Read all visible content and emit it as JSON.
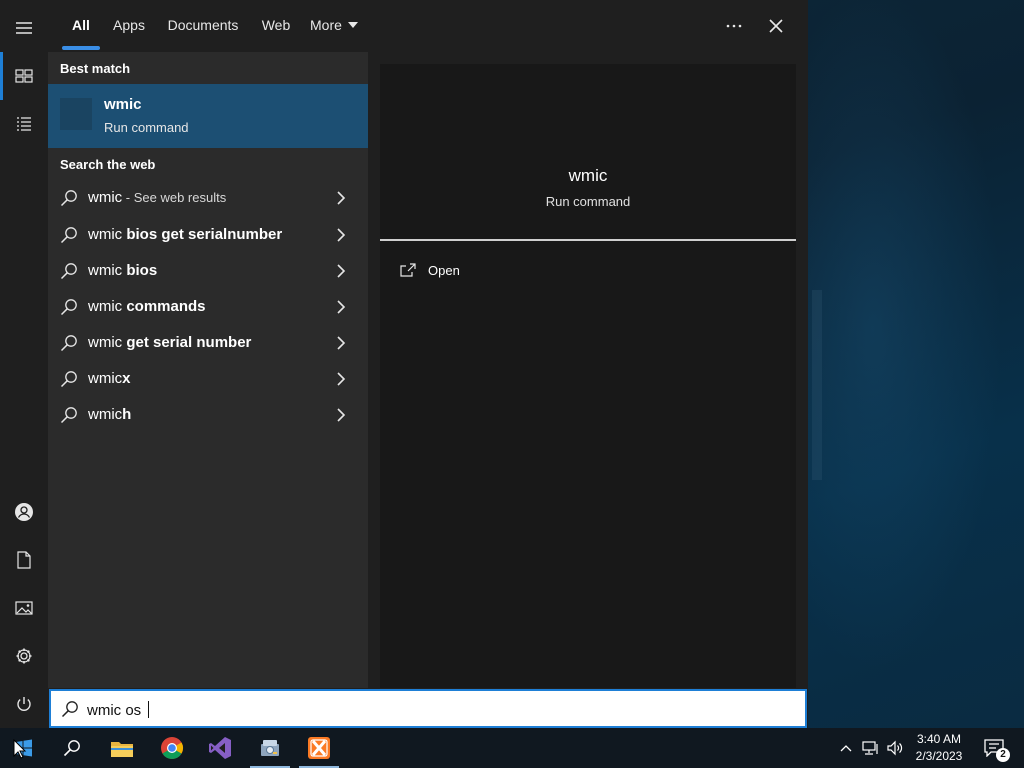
{
  "tabs": [
    {
      "label": "All",
      "active": true
    },
    {
      "label": "Apps"
    },
    {
      "label": "Documents"
    },
    {
      "label": "Web"
    },
    {
      "label": "More"
    }
  ],
  "toolbar": {
    "options_icon": "ellipsis-icon",
    "close_icon": "close-icon"
  },
  "best_match": {
    "section_title": "Best match",
    "name": "wmic",
    "type": "Run command"
  },
  "web": {
    "section_title": "Search the web",
    "items": [
      {
        "prefix": "wmic",
        "highlight": "",
        "suffix": " - See web results"
      },
      {
        "prefix": "wmic ",
        "highlight": "bios get serialnumber",
        "suffix": ""
      },
      {
        "prefix": "wmic ",
        "highlight": "bios",
        "suffix": ""
      },
      {
        "prefix": "wmic ",
        "highlight": "commands",
        "suffix": ""
      },
      {
        "prefix": "wmic ",
        "highlight": "get serial number",
        "suffix": ""
      },
      {
        "prefix": "wmic",
        "highlight": "x",
        "suffix": ""
      },
      {
        "prefix": "wmic",
        "highlight": "h",
        "suffix": ""
      }
    ]
  },
  "preview": {
    "name": "wmic",
    "type": "Run command",
    "actions": [
      {
        "label": "Open",
        "icon": "open-external-icon"
      }
    ]
  },
  "search": {
    "value": "wmic os "
  },
  "rail": {
    "icons": [
      "hamburger-menu-icon",
      "home-tiles-icon",
      "documents-list-icon",
      "user-icon",
      "document-icon",
      "pictures-icon",
      "settings-icon",
      "power-icon"
    ]
  },
  "taskbar": {
    "apps": [
      "windows-start-icon",
      "search-icon",
      "file-explorer-icon",
      "chrome-icon",
      "visual-studio-icon",
      "disk-utility-icon",
      "xampp-icon"
    ],
    "time": "3:40 AM",
    "date": "2/3/2023",
    "notification_count": "2"
  },
  "colors": {
    "accent": "#1e7fd6",
    "selection": "#1c4f73",
    "panel": "#2b2b2b",
    "preview": "#181818"
  }
}
